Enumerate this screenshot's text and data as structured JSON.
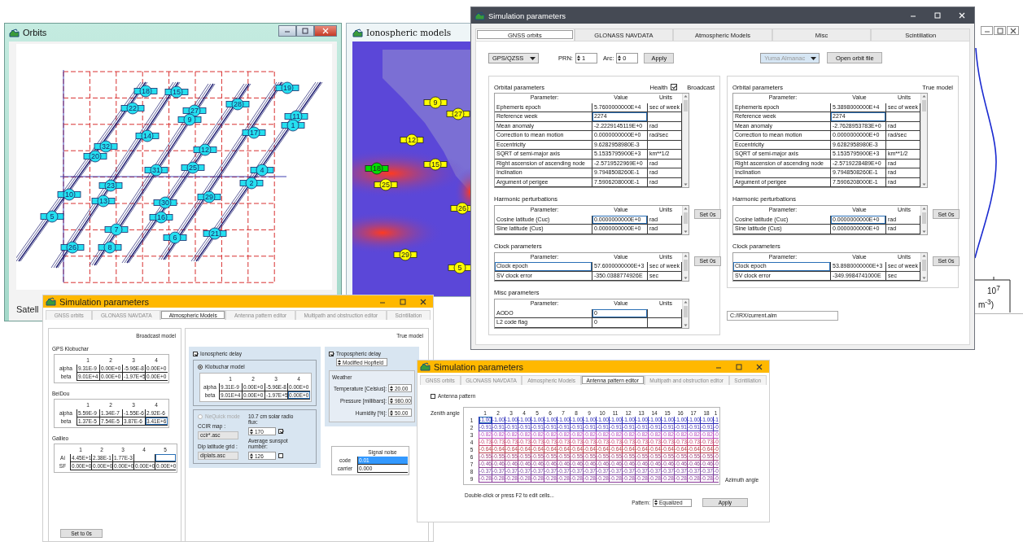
{
  "orbits_window": {
    "title": "Orbits",
    "status_label": "Satell",
    "satellites": [
      {
        "label": "18"
      },
      {
        "label": "15"
      },
      {
        "label": "22"
      },
      {
        "label": "27"
      },
      {
        "label": "9"
      },
      {
        "label": "28"
      },
      {
        "label": "19"
      },
      {
        "label": "11"
      },
      {
        "label": "1"
      },
      {
        "label": "14"
      },
      {
        "label": "17"
      },
      {
        "label": "32"
      },
      {
        "label": "12"
      },
      {
        "label": "20"
      },
      {
        "label": "31"
      },
      {
        "label": "25"
      },
      {
        "label": "4"
      },
      {
        "label": "23"
      },
      {
        "label": "2"
      },
      {
        "label": "10"
      },
      {
        "label": "13"
      },
      {
        "label": "29"
      },
      {
        "label": "30"
      },
      {
        "label": "16"
      },
      {
        "label": "5"
      },
      {
        "label": "7"
      },
      {
        "label": "6"
      },
      {
        "label": "21"
      },
      {
        "label": "26"
      },
      {
        "label": "8"
      }
    ]
  },
  "ionosphere_window": {
    "title": "Ionospheric models",
    "satellites": [
      {
        "label": "9",
        "color": "#ffff00"
      },
      {
        "label": "27",
        "color": "#ffff00"
      },
      {
        "label": "12",
        "color": "#ffff00"
      },
      {
        "label": "15",
        "color": "#ffff00"
      },
      {
        "label": "18",
        "color": "#00dd00"
      },
      {
        "label": "25",
        "color": "#ffff00"
      },
      {
        "label": "26",
        "color": "#ffff00"
      },
      {
        "label": "29",
        "color": "#ffff00"
      },
      {
        "label": "5",
        "color": "#ffff00"
      }
    ]
  },
  "density_window": {
    "tick_label": "10$^{7}$",
    "unit_label": "m$^{-3}$)"
  },
  "main_window": {
    "title": "Simulation parameters",
    "tabs": [
      {
        "label": "GNSS orbits",
        "selected": true
      },
      {
        "label": "GLONASS NAVDATA",
        "selected": false
      },
      {
        "label": "Atmospheric Models",
        "selected": false
      },
      {
        "label": "Misc",
        "selected": false
      },
      {
        "label": "Scintillation",
        "selected": false
      }
    ],
    "toolbar": {
      "constellation": "GPS/QZSS",
      "prn_label": "PRN:",
      "prn": "1",
      "arc_label": "Arc:",
      "arc": "0",
      "apply": "Apply",
      "almanac": {
        "value": "Yuma Almanac",
        "disabled": true
      },
      "open_file": "Open orbit file"
    },
    "broadcast_panel": {
      "model_label": "Broadcast",
      "health": {
        "label": "Health",
        "checked": true
      },
      "sections": [
        {
          "title": "Orbital parameters",
          "kind": "value",
          "columns": [
            "Parameter:",
            "Value",
            "Units"
          ],
          "rows": [
            {
              "cells": [
                "Ephemeris epoch",
                "5.7600000000E+4",
                "sec of week"
              ],
              "selected": false
            },
            {
              "cells": [
                "Reference week",
                "2274"
              ],
              "selected": true
            },
            {
              "cells": [
                "Mean anomaly",
                "-2.2229145119E+0",
                "rad"
              ],
              "selected": false
            },
            {
              "cells": [
                "Correction to mean motion",
                "0.0000000000E+0",
                "rad/sec"
              ],
              "selected": false
            },
            {
              "cells": [
                "Eccentricity",
                "9.6282958980E-3"
              ],
              "selected": false
            },
            {
              "cells": [
                "SQRT of semi-major axis",
                "5.1535795900E+3",
                "km**1/2"
              ],
              "selected": false
            },
            {
              "cells": [
                "Right ascension of ascending node",
                "-2.5719522969E+0",
                "rad"
              ],
              "selected": false
            },
            {
              "cells": [
                "Inclination",
                "9.7948508260E-1",
                "rad"
              ],
              "selected": false
            },
            {
              "cells": [
                "Argument of perigee",
                "7.5906208000E-1",
                "rad"
              ],
              "selected": false
            }
          ]
        },
        {
          "title": "Harmonic perturbations",
          "kind": "value",
          "button": "Set 0s",
          "columns": [
            "Parameter:",
            "Value",
            "Units"
          ],
          "rows": [
            {
              "cells": [
                "Cosine latitude (Cuc)",
                "0.0000000000E+0",
                "rad"
              ],
              "selected": true
            },
            {
              "cells": [
                "Sine latitude (Cus)",
                "0.0000000000E+0",
                "rad"
              ],
              "selected": false
            }
          ]
        },
        {
          "title": "Clock parameters",
          "kind": "parameter",
          "button": "Set 0s",
          "columns": [
            "Parameter:",
            "Value",
            "Units"
          ],
          "rows": [
            {
              "cells": [
                "Clock epoch",
                "57.6000000000E+3",
                "sec of week"
              ],
              "selected": true
            },
            {
              "cells": [
                "SV clock error",
                "-350.0388774926E",
                "sec"
              ],
              "selected": false
            }
          ]
        },
        {
          "title": "Misc parameters",
          "kind": "value",
          "columns": [
            "Parameter:",
            "Value",
            "Units"
          ],
          "rows": [
            {
              "cells": [
                "AODO",
                "0"
              ],
              "selected": true
            },
            {
              "cells": [
                "L2 code flag",
                "0"
              ],
              "selected": false
            }
          ]
        }
      ]
    },
    "true_panel": {
      "model_label": "True model",
      "sections": [
        {
          "title": "Orbital parameters",
          "kind": "value",
          "columns": [
            "Parameter:",
            "Value",
            "Units"
          ],
          "rows": [
            {
              "cells": [
                "Ephemeris epoch",
                "5.3898000000E+4",
                "sec of week"
              ],
              "selected": false
            },
            {
              "cells": [
                "Reference week",
                "2274"
              ],
              "selected": true
            },
            {
              "cells": [
                "Mean anomaly",
                "-2.7628953783E+0",
                "rad"
              ],
              "selected": false
            },
            {
              "cells": [
                "Correction to mean motion",
                "0.0000000000E+0",
                "rad/sec"
              ],
              "selected": false
            },
            {
              "cells": [
                "Eccentricity",
                "9.6282958980E-3"
              ],
              "selected": false
            },
            {
              "cells": [
                "SQRT of semi-major axis",
                "5.1535795900E+3",
                "km**1/2"
              ],
              "selected": false
            },
            {
              "cells": [
                "Right ascension of ascending node",
                "-2.5719228489E+0",
                "rad"
              ],
              "selected": false
            },
            {
              "cells": [
                "Inclination",
                "9.7948508260E-1",
                "rad"
              ],
              "selected": false
            },
            {
              "cells": [
                "Argument of perigee",
                "7.5906208000E-1",
                "rad"
              ],
              "selected": false
            }
          ]
        },
        {
          "title": "Harmonic perturbations",
          "kind": "value",
          "button": "Set 0s",
          "columns": [
            "Parameter:",
            "Value",
            "Units"
          ],
          "rows": [
            {
              "cells": [
                "Cosine latitude (Cuc)",
                "0.0000000000E+0",
                "rad"
              ],
              "selected": true
            },
            {
              "cells": [
                "Sine latitude (Cus)",
                "0.0000000000E+0",
                "rad"
              ],
              "selected": false
            }
          ]
        },
        {
          "title": "Clock parameters",
          "kind": "parameter",
          "button": "Set 0s",
          "columns": [
            "Parameter:",
            "Value",
            "Units"
          ],
          "rows": [
            {
              "cells": [
                "Clock epoch",
                "53.8980000000E+3",
                "sec of week"
              ],
              "selected": true
            },
            {
              "cells": [
                "SV clock error",
                "-349.9984741000E",
                "sec"
              ],
              "selected": false
            }
          ]
        }
      ]
    },
    "file_path": "C:/IRX/current.alm"
  },
  "atmosphere_window": {
    "title": "Simulation parameters",
    "tabs": [
      {
        "label": "GNSS orbits",
        "selected": false
      },
      {
        "label": "GLONASS NAVDATA",
        "selected": false
      },
      {
        "label": "Atmospheric Models",
        "selected": true
      },
      {
        "label": "Antenna pattern editor",
        "selected": false
      },
      {
        "label": "Multipath and obstruction editor",
        "selected": false
      },
      {
        "label": "Scintillation",
        "selected": false
      }
    ],
    "broadcast_model": {
      "title": "Broadcast model",
      "reset_button": "Set to 0s",
      "tables": [
        {
          "title": "GPS Klobuchar",
          "kind": "last",
          "columns": [
            "1",
            "2",
            "3",
            "4"
          ],
          "rows": [
            {
              "label": "alpha",
              "cells": [
                "9.31E-9",
                "0.00E+0",
                "-5.96E-8",
                "0.00E+0"
              ],
              "selected": false
            },
            {
              "label": "beta",
              "cells": [
                "9.01E+4",
                "0.00E+0",
                "-1.97E+5",
                "0.00E+0"
              ],
              "selected": false
            }
          ]
        },
        {
          "title": "BeiDou",
          "kind": "last",
          "columns": [
            "1",
            "2",
            "3",
            "4"
          ],
          "rows": [
            {
              "label": "alpha",
              "cells": [
                "5.59E-9",
                "1.34E-7",
                "-1.55E-6",
                "2.92E-6"
              ],
              "selected": false
            },
            {
              "label": "beta",
              "cells": [
                "1.37E-5",
                "7.54E-5",
                "3.87E-6",
                "3.41E+6"
              ],
              "selected": true
            }
          ]
        },
        {
          "title": "Galileo",
          "kind": "last",
          "columns": [
            "1",
            "2",
            "3",
            "4",
            "5"
          ],
          "rows": [
            {
              "label": "Ai",
              "cells": [
                "4.45E+1",
                "2.38E-1",
                "1.77E-3"
              ],
              "selected": true
            },
            {
              "label": "SF",
              "cells": [
                "0.00E+0",
                "0.00E+0",
                "0.00E+0",
                "0.00E+0",
                "0.00E+0"
              ],
              "selected": false
            }
          ]
        }
      ]
    },
    "true_model": {
      "title": "True model",
      "ionospheric_delay": {
        "label": "Ionospheric delay",
        "checked": true
      },
      "klobuchar": {
        "label": "Klobuchar model",
        "selected": true,
        "table": {
          "kind": "last",
          "columns": [
            "1",
            "2",
            "3",
            "4"
          ],
          "rows": [
            {
              "label": "alpha",
              "cells": [
                "9.31E-9",
                "0.00E+0",
                "-5.96E-8",
                "0.00E+0"
              ],
              "selected": false
            },
            {
              "label": "beta",
              "cells": [
                "9.01E+4",
                "0.00E+0",
                "-1.97E+5",
                "0.00E+0"
              ],
              "selected": true
            }
          ]
        }
      },
      "nequick": {
        "label": "NeQuick mode",
        "selected": false,
        "disabled": true,
        "ccir_label": "CCIR map :",
        "ccir_value": "ccir*.asc",
        "dip_label": "Dip latitude grid :",
        "dip_value": "diplats.asc",
        "flux_label": "10.7 cm solar radio flux:",
        "flux_value": "170",
        "flux_checked": true,
        "sunspot_label": "Average sunspot number:",
        "sunspot_value": "126",
        "sunspot_checked": false
      },
      "tropospheric_delay": {
        "label": "Tropospheric delay",
        "checked": true,
        "model": "Modified Hopfield"
      },
      "weather": {
        "title": "Weather",
        "fields": [
          {
            "label": "Temperature [Celsius]:",
            "value": "20.00"
          },
          {
            "label": "Pressure [millibars]:",
            "value": "980.00"
          },
          {
            "label": "Humidity [%]:",
            "value": "50.00"
          }
        ]
      },
      "signal_noise": {
        "kind": "fill",
        "columns": [
          "Signal noise"
        ],
        "rows": [
          {
            "label": "code",
            "cells": [
              "0.01"
            ],
            "selected": true
          },
          {
            "label": "carrier",
            "cells": [
              "0.000"
            ],
            "selected": false
          }
        ]
      }
    }
  },
  "antenna_window": {
    "title": "Simulation parameters",
    "tabs": [
      {
        "label": "GNSS orbits",
        "selected": false
      },
      {
        "label": "GLONASS NAVDATA",
        "selected": false
      },
      {
        "label": "Atmospheric Models",
        "selected": false
      },
      {
        "label": "Antenna pattern editor",
        "selected": true
      },
      {
        "label": "Multipath and obstruction editor",
        "selected": false
      },
      {
        "label": "Scintillation",
        "selected": false
      }
    ],
    "pattern_checkbox": {
      "label": "Antenna pattern",
      "checked": false
    },
    "zenith_label": "Zenith angle",
    "azimuth_label": "Azimuth angle",
    "grid": {
      "kind": "first",
      "columns": [
        "1",
        "2",
        "3",
        "4",
        "5",
        "6",
        "7",
        "8",
        "9",
        "10",
        "11",
        "12",
        "13",
        "14",
        "15",
        "16",
        "17",
        "18",
        "1"
      ],
      "rows": [
        {
          "label": "1",
          "color": "#2b2bb8",
          "selected": true,
          "cells": [
            "-1.00",
            "-1.00",
            "-1.00",
            "-1.00",
            "-1.00",
            "-1.00",
            "-1.00",
            "-1.00",
            "-1.00",
            "-1.00",
            "-1.00",
            "-1.00",
            "-1.00",
            "-1.00",
            "-1.00",
            "-1.00",
            "-1.00",
            "-1.00",
            "-1"
          ]
        },
        {
          "label": "2",
          "color": "#4b3ab8",
          "selected": false,
          "cells": [
            "-0.91",
            "-0.91",
            "-0.91",
            "-0.91",
            "-0.91",
            "-0.91",
            "-0.91",
            "-0.91",
            "-0.91",
            "-0.91",
            "-0.91",
            "-0.91",
            "-0.91",
            "-0.91",
            "-0.91",
            "-0.91",
            "-0.91",
            "-0.91",
            "-0"
          ]
        },
        {
          "label": "3",
          "color": "#b84ac0",
          "selected": false,
          "cells": [
            "-0.82",
            "-0.82",
            "-0.82",
            "-0.82",
            "-0.82",
            "-0.82",
            "-0.82",
            "-0.82",
            "-0.82",
            "-0.82",
            "-0.82",
            "-0.82",
            "-0.82",
            "-0.82",
            "-0.82",
            "-0.82",
            "-0.82",
            "-0.82",
            "-0"
          ]
        },
        {
          "label": "4",
          "color": "#c2406a",
          "selected": false,
          "cells": [
            "-0.73",
            "-0.73",
            "-0.73",
            "-0.73",
            "-0.73",
            "-0.73",
            "-0.73",
            "-0.73",
            "-0.73",
            "-0.73",
            "-0.73",
            "-0.73",
            "-0.73",
            "-0.73",
            "-0.73",
            "-0.73",
            "-0.73",
            "-0.73",
            "-0"
          ]
        },
        {
          "label": "5",
          "color": "#b8404a",
          "selected": false,
          "cells": [
            "-0.64",
            "-0.64",
            "-0.64",
            "-0.64",
            "-0.64",
            "-0.64",
            "-0.64",
            "-0.64",
            "-0.64",
            "-0.64",
            "-0.64",
            "-0.64",
            "-0.64",
            "-0.64",
            "-0.64",
            "-0.64",
            "-0.64",
            "-0.64",
            "-0"
          ]
        },
        {
          "label": "6",
          "color": "#a0407a",
          "selected": false,
          "cells": [
            "-0.55",
            "-0.55",
            "-0.55",
            "-0.55",
            "-0.55",
            "-0.55",
            "-0.55",
            "-0.55",
            "-0.55",
            "-0.55",
            "-0.55",
            "-0.55",
            "-0.55",
            "-0.55",
            "-0.55",
            "-0.55",
            "-0.55",
            "-0.55",
            "-0"
          ]
        },
        {
          "label": "7",
          "color": "#8a3c8c",
          "selected": false,
          "cells": [
            "-0.46",
            "-0.46",
            "-0.46",
            "-0.46",
            "-0.46",
            "-0.46",
            "-0.46",
            "-0.46",
            "-0.46",
            "-0.46",
            "-0.46",
            "-0.46",
            "-0.46",
            "-0.46",
            "-0.46",
            "-0.46",
            "-0.46",
            "-0.46",
            "-0"
          ]
        },
        {
          "label": "8",
          "color": "#7a46a0",
          "selected": false,
          "cells": [
            "-0.37",
            "-0.37",
            "-0.37",
            "-0.37",
            "-0.37",
            "-0.37",
            "-0.37",
            "-0.37",
            "-0.37",
            "-0.37",
            "-0.37",
            "-0.37",
            "-0.37",
            "-0.37",
            "-0.37",
            "-0.37",
            "-0.37",
            "-0.37",
            "-0"
          ]
        },
        {
          "label": "9",
          "color": "#8a3a9a",
          "selected": false,
          "cells": [
            "-0.28",
            "-0.28",
            "-0.28",
            "-0.28",
            "-0.28",
            "-0.28",
            "-0.28",
            "-0.28",
            "-0.28",
            "-0.28",
            "-0.28",
            "-0.28",
            "-0.28",
            "-0.28",
            "-0.28",
            "-0.28",
            "-0.28",
            "-0.28",
            "-0"
          ]
        }
      ]
    },
    "hint": "Double-click or press F2 to edit cells...",
    "pattern": {
      "label": "Pattern:",
      "value": "Equalized"
    },
    "apply_button": "Apply"
  }
}
